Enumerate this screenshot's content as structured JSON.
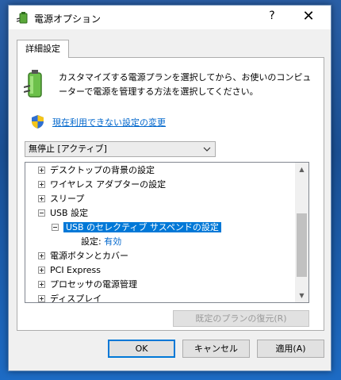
{
  "window": {
    "title": "電源オプション",
    "help_label": "?",
    "close_label": "✕"
  },
  "tab": {
    "label": "詳細設定"
  },
  "description": "カスタマイズする電源プランを選択してから、お使いのコンピューターで電源を管理する方法を選択してください。",
  "link": "現在利用できない設定の変更",
  "plan_select": {
    "value": "無停止 [アクティブ]"
  },
  "tree": {
    "items": [
      {
        "label": "デスクトップの背景の設定",
        "expander": "+"
      },
      {
        "label": "ワイヤレス アダプターの設定",
        "expander": "+"
      },
      {
        "label": "スリープ",
        "expander": "+"
      },
      {
        "label": "USB 設定",
        "expander": "-"
      },
      {
        "label": "USB のセレクティブ サスペンドの設定",
        "expander": "-",
        "selected": true
      },
      {
        "label": "設定:",
        "value": "有効"
      },
      {
        "label": "電源ボタンとカバー",
        "expander": "+"
      },
      {
        "label": "PCI Express",
        "expander": "+"
      },
      {
        "label": "プロセッサの電源管理",
        "expander": "+"
      },
      {
        "label": "ディスプレイ",
        "expander": "+"
      }
    ]
  },
  "buttons": {
    "restore": "既定のプランの復元(R)",
    "ok": "OK",
    "cancel": "キャンセル",
    "apply": "適用(A)"
  },
  "colors": {
    "accent": "#0078d7",
    "link": "#0066cc"
  }
}
